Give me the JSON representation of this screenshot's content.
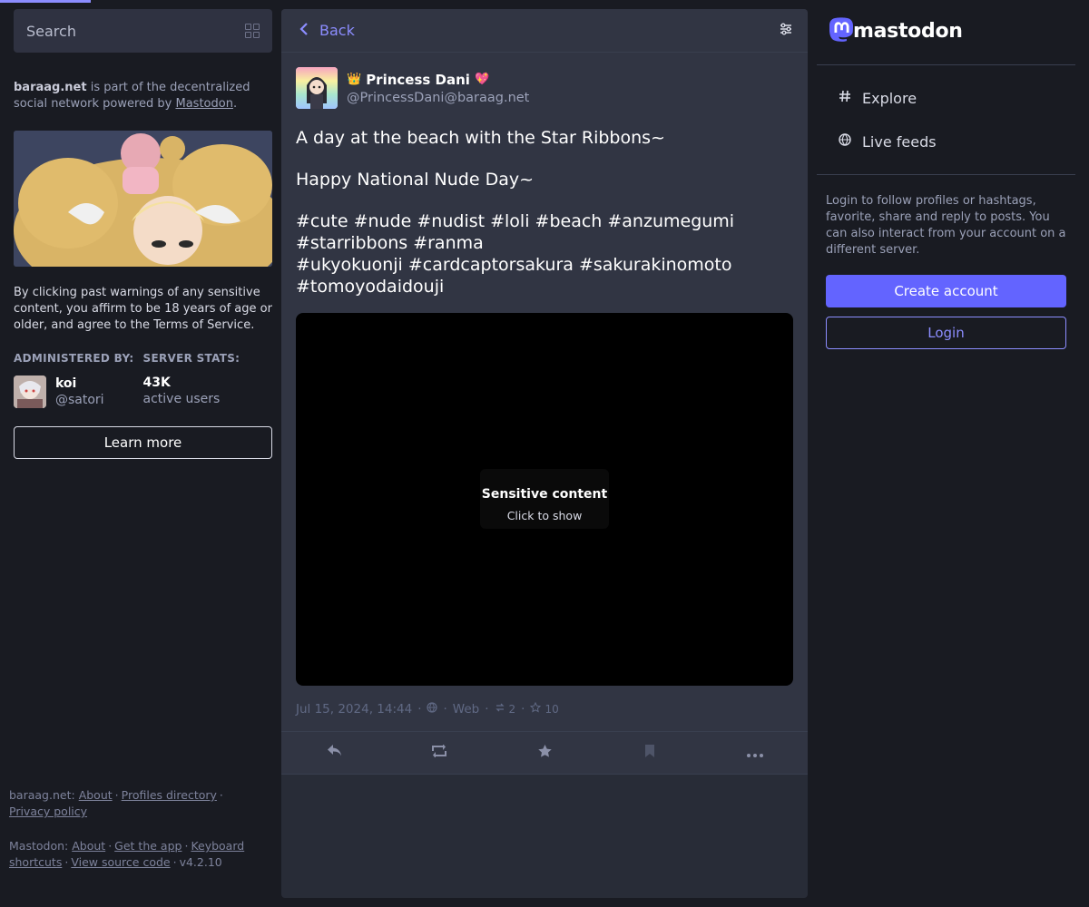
{
  "colors": {
    "background": "#191b22",
    "panel": "#282c37",
    "accent": "#6364ff",
    "accent_light": "#8c8dff",
    "muted": "#9ba1b8"
  },
  "left": {
    "search_placeholder": "Search",
    "search_icon": "grid-icon",
    "server_intro": {
      "domain": "baraag.net",
      "text_before": " is part of the decentralized social network powered by ",
      "link": "Mastodon",
      "text_after": "."
    },
    "warning": "By clicking past warnings of any sensitive content, you affirm to be 18 years of age or older, and agree to the Terms of Service.",
    "admin_heading": "ADMINISTERED BY:",
    "admin_name": "koi",
    "admin_handle": "@satori",
    "stats_heading": "SERVER STATS:",
    "stats_value": "43K",
    "stats_label": "active users",
    "learn_more": "Learn more",
    "footer": {
      "server": "baraag.net",
      "colon": ":",
      "about": "About",
      "profiles": "Profiles directory",
      "privacy": "Privacy policy",
      "mastodon": "Mastodon",
      "m_about": "About",
      "get_app": "Get the app",
      "keyboard": "Keyboard shortcuts",
      "source": "View source code",
      "version": "v4.2.10",
      "dot": "·"
    }
  },
  "center": {
    "back_label": "Back",
    "back_icon": "chevron-left-icon",
    "settings_icon": "sliders-icon",
    "post": {
      "display_name": "Princess Dani",
      "emoji_before": "👑",
      "emoji_after": "💖",
      "account": "@PrincessDani@baraag.net",
      "content": [
        "A day at the beach with the Star Ribbons~",
        "Happy National Nude Day~",
        "#cute #nude #nudist #loli #beach #anzumegumi #starribbons #ranma",
        "#ukyokuonji #cardcaptorsakura #sakurakinomoto #tomoyodaidouji"
      ],
      "sensitive_title": "Sensitive content",
      "sensitive_sub": "Click to show",
      "timestamp": "Jul 15, 2024, 14:44",
      "visibility_icon": "globe-icon",
      "application": "Web",
      "boosts": "2",
      "favourites": "10",
      "sep": "·"
    }
  },
  "right": {
    "logo_text": "mastodon",
    "nav": [
      {
        "label": "Explore",
        "icon": "hashtag-icon"
      },
      {
        "label": "Live feeds",
        "icon": "globe-icon"
      }
    ],
    "login_text": "Login to follow profiles or hashtags, favorite, share and reply to posts. You can also interact from your account on a different server.",
    "create_account": "Create account",
    "login": "Login"
  }
}
